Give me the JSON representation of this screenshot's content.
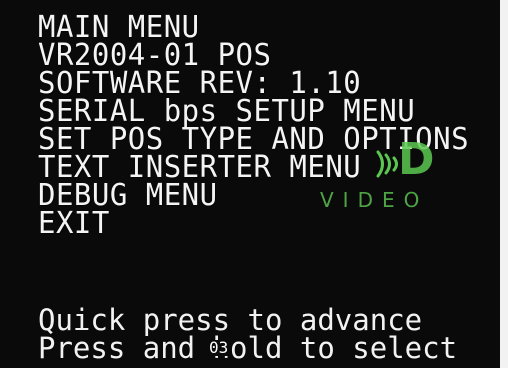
{
  "menu": {
    "title": "MAIN MENU",
    "model": "VR2004-01 POS",
    "software_rev": "SOFTWARE REV: 1.10",
    "items": [
      "SERIAL bps SETUP MENU",
      "SET POS TYPE AND OPTIONS",
      "TEXT INSERTER MENU",
      "DEBUG MENU",
      "EXIT"
    ]
  },
  "instructions": {
    "line1": "Quick press to advance",
    "line2": "Press and hold to select"
  },
  "channel_number": "03",
  "watermark": {
    "logo_letter": "D",
    "logo_text": "VIDEO",
    "color": "#5ac850"
  }
}
